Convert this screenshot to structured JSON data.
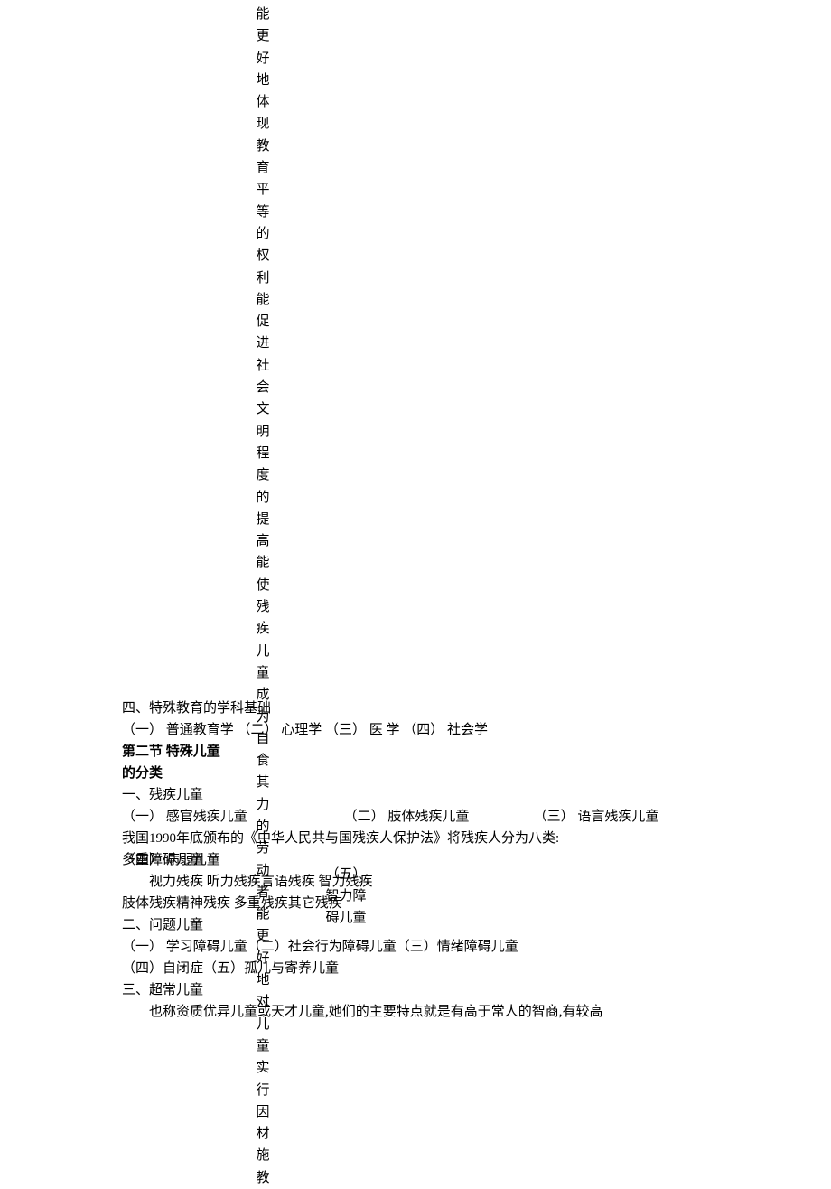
{
  "vertical_text": "能更好地体现教育平等的权利能促进社会文明程度的提高能使残疾儿童成为自食其力的劳动者能更好地对儿童实行因材施教",
  "s4_title": "四、特殊教育的学科基础",
  "s4_items": "（一） 普通教育学 （二） 心理学 （三） 医 学 （四） 社会学",
  "section2_title": "第二节 特殊儿童的分类",
  "c1_title": "一、残疾儿童",
  "c1_r1": {
    "a": "（一） 感官残疾儿童",
    "b": "（二） 肢体残疾儿童",
    "c": "（三） 语言残疾儿童"
  },
  "c1_r2": {
    "a": "（四） 病弱儿童",
    "b": "（五） 智力障碍儿童",
    "c": "多重障碍儿童"
  },
  "law_line": "我国1990年底颁布的《中华人民共与国残疾人保护法》将残疾人分为八类:",
  "law_cats1": "视力残疾  听力残疾言语残疾  智力残疾",
  "law_cats2": "肢体残疾精神残疾  多重残疾其它残疾",
  "c2_title": "二、问题儿童",
  "c2_items1": "（一） 学习障碍儿童（二）社会行为障碍儿童（三）情绪障碍儿童",
  "c2_items2": "（四）自闭症（五）孤儿与寄养儿童",
  "c3_title": "三、超常儿童",
  "c3_desc": "也称资质优异儿童或天才儿童,她们的主要特点就是有高于常人的智商,有较高",
  "overlay": {
    "a": "（五）",
    "b": "智力障",
    "c": "碍儿童"
  }
}
